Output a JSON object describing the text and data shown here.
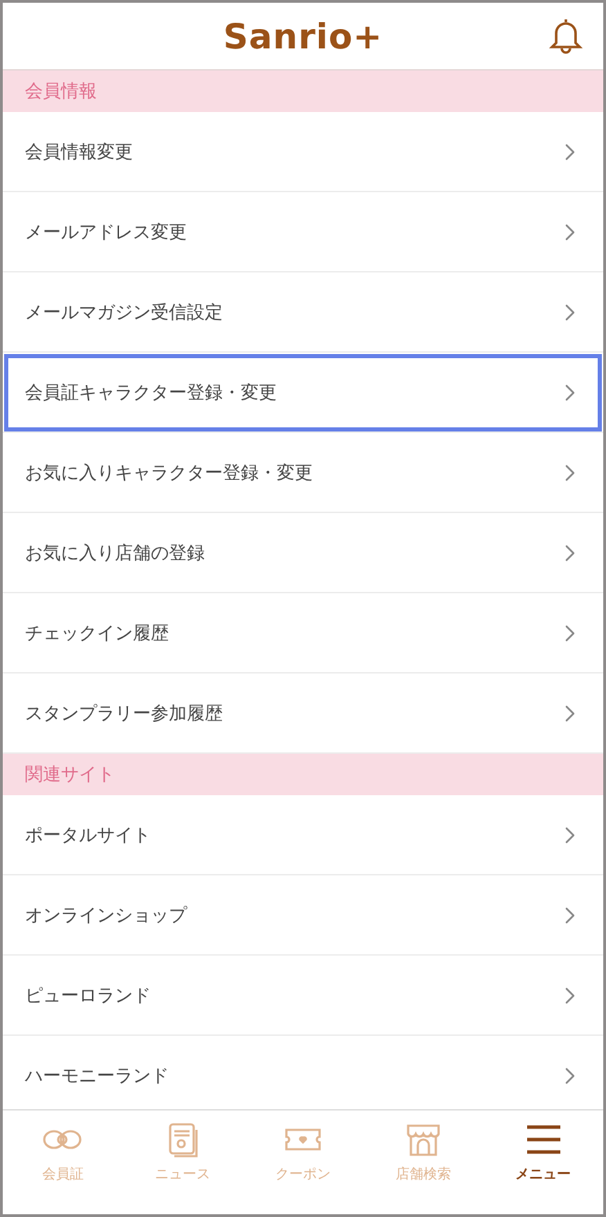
{
  "header": {
    "logo": "Sanrio+"
  },
  "sections": [
    {
      "title": "会員情報",
      "items": [
        {
          "label": "会員情報変更",
          "selected": false
        },
        {
          "label": "メールアドレス変更",
          "selected": false
        },
        {
          "label": "メールマガジン受信設定",
          "selected": false
        },
        {
          "label": "会員証キャラクター登録・変更",
          "selected": true
        },
        {
          "label": "お気に入りキャラクター登録・変更",
          "selected": false
        },
        {
          "label": "お気に入り店舗の登録",
          "selected": false
        },
        {
          "label": "チェックイン履歴",
          "selected": false
        },
        {
          "label": "スタンプラリー参加履歴",
          "selected": false
        }
      ]
    },
    {
      "title": "関連サイト",
      "items": [
        {
          "label": "ポータルサイト",
          "selected": false
        },
        {
          "label": "オンラインショップ",
          "selected": false
        },
        {
          "label": "ピューロランド",
          "selected": false
        },
        {
          "label": "ハーモニーランド",
          "selected": false
        }
      ]
    }
  ],
  "tabs": [
    {
      "label": "会員証",
      "kind": "card",
      "selected": false
    },
    {
      "label": "ニュース",
      "kind": "news",
      "selected": false
    },
    {
      "label": "クーポン",
      "kind": "coupon",
      "selected": false
    },
    {
      "label": "店舗検索",
      "kind": "shop",
      "selected": false
    },
    {
      "label": "メニュー",
      "kind": "menu",
      "selected": true
    }
  ]
}
